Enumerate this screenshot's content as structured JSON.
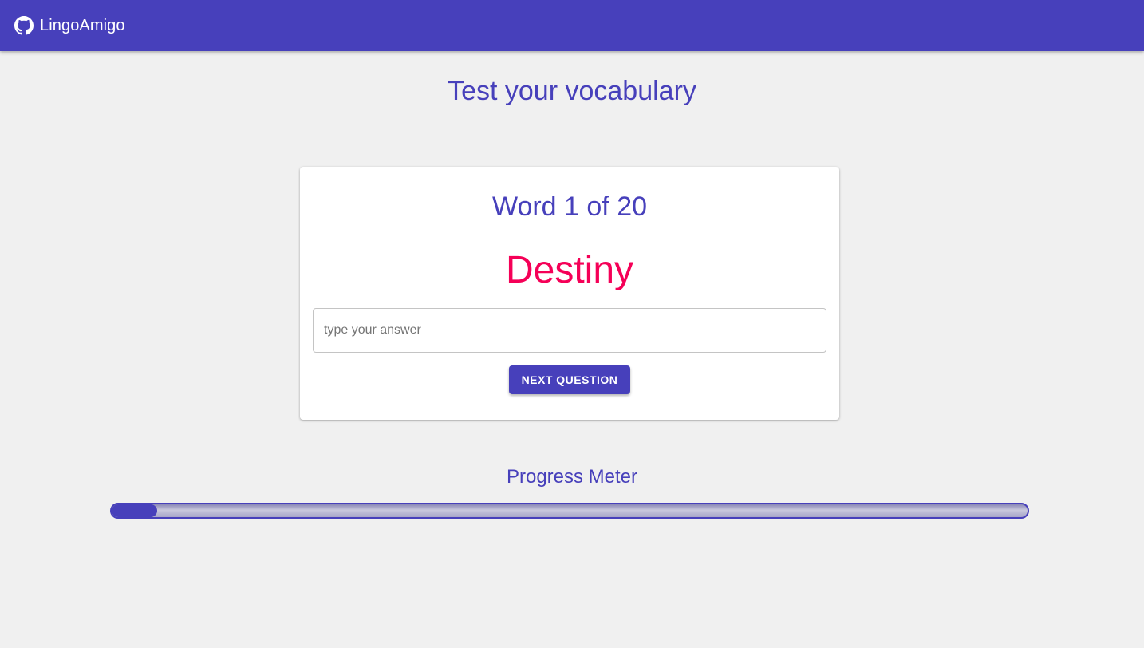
{
  "appbar": {
    "brand_icon": "github-icon",
    "brand_name": "LingoAmigo",
    "color": "#4740bb"
  },
  "page": {
    "title": "Test your vocabulary"
  },
  "quiz": {
    "counter": "Word 1 of 20",
    "word": "Destiny",
    "word_color": "#f50057",
    "answer_value": "",
    "answer_placeholder": "type your answer",
    "next_label": "Next Question"
  },
  "progress": {
    "title": "Progress Meter",
    "fraction": 0.05
  }
}
